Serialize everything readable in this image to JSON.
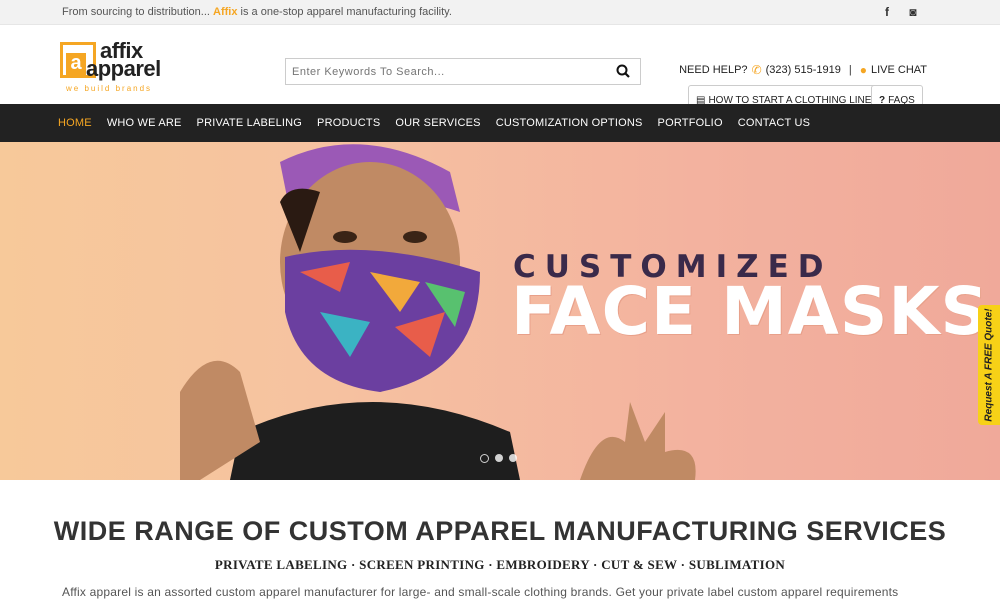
{
  "topbar": {
    "tagline_pre": "From sourcing to distribution...",
    "tagline_brand": "Affix",
    "tagline_post": "is a one-stop apparel manufacturing facility.",
    "social": [
      {
        "icon": "facebook-icon",
        "glyph": "f"
      },
      {
        "icon": "instagram-icon",
        "glyph": "◙"
      }
    ]
  },
  "logo": {
    "word1": "affix",
    "word2": "apparel",
    "tagline": "we build brands",
    "mark_letter": "a"
  },
  "search": {
    "placeholder": "Enter Keywords To Search...",
    "value": ""
  },
  "help": {
    "label": "NEED HELP?",
    "phone": "(323) 515-1919",
    "separator": "|",
    "chat": "LIVE CHAT"
  },
  "buttons": {
    "start": "HOW TO START A CLOTHING LINE",
    "faqs": "FAQS"
  },
  "nav": {
    "items": [
      {
        "label": "HOME",
        "active": true
      },
      {
        "label": "WHO WE ARE",
        "active": false
      },
      {
        "label": "PRIVATE LABELING",
        "active": false
      },
      {
        "label": "PRODUCTS",
        "active": false
      },
      {
        "label": "OUR SERVICES",
        "active": false
      },
      {
        "label": "CUSTOMIZATION OPTIONS",
        "active": false
      },
      {
        "label": "PORTFOLIO",
        "active": false
      },
      {
        "label": "CONTACT US",
        "active": false
      }
    ]
  },
  "hero": {
    "title_line1": "CUSTOMIZED",
    "title_line2": "FACE MASKS",
    "slides": 3,
    "current_slide": 1
  },
  "quote_tab": "Request A FREE Quote!",
  "section": {
    "heading": "WIDE RANGE OF CUSTOM APPAREL MANUFACTURING SERVICES",
    "subheading": "PRIVATE LABELING · SCREEN PRINTING · EMBROIDERY · CUT & SEW · SUBLIMATION",
    "paragraph": "Affix apparel is an assorted custom apparel manufacturer for large- and small-scale clothing brands. Get your private label custom apparel requirements"
  },
  "colors": {
    "accent": "#f5a623",
    "nav_bg": "#222222",
    "quote_bg": "#f7d117"
  }
}
